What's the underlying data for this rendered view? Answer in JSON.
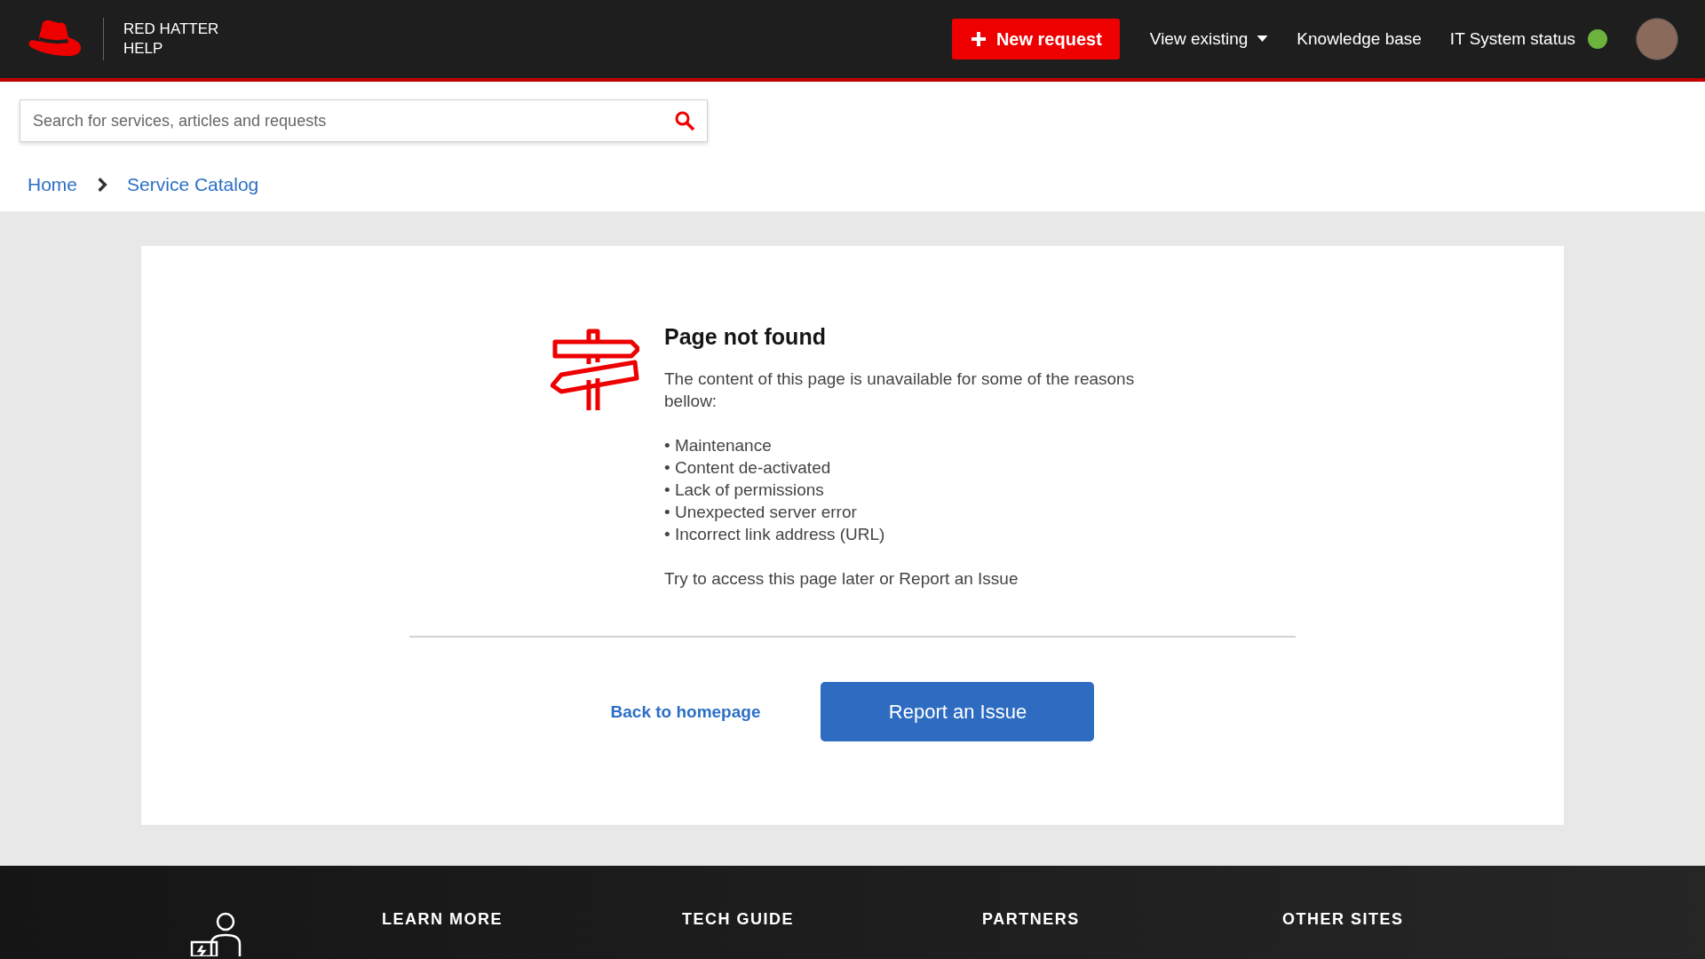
{
  "brand": {
    "line_1": "RED HATTER",
    "line_2": "HELP"
  },
  "nav": {
    "new_request": "New request",
    "view_existing": "View existing",
    "knowledge_base": "Knowledge base",
    "status": {
      "label": "IT System status",
      "ok": true
    }
  },
  "search": {
    "placeholder": "Search for services, articles and requests"
  },
  "breadcrumb": [
    "Home",
    "Service Catalog"
  ],
  "error": {
    "title": "Page not found",
    "intro": "The content of this page is unavailable for some of the reasons bellow:",
    "reasons": [
      "Maintenance",
      "Content de-activated",
      "Lack of permissions",
      "Unexpected server error",
      "Incorrect link address (URL)"
    ],
    "bullet": "•",
    "hint": "Try to access this page later or Report an Issue"
  },
  "actions": {
    "back": "Back to homepage",
    "report": "Report an Issue"
  },
  "footer": {
    "columns": [
      "LEARN MORE",
      "TECH GUIDE",
      "PARTNERS",
      "OTHER SITES"
    ]
  }
}
